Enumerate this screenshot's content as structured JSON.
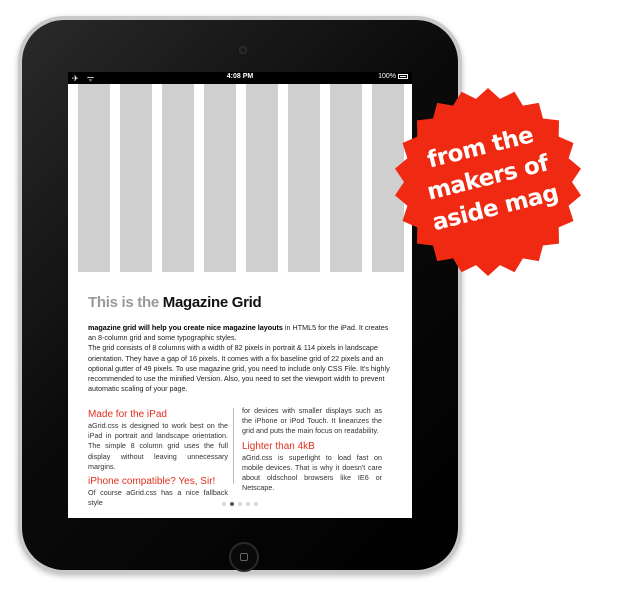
{
  "status_bar": {
    "left_icons": [
      "airplane-icon",
      "wifi-icon"
    ],
    "left_glyphs": "✈ ᯤ",
    "time": "4:08 PM",
    "battery": "100%"
  },
  "grid": {
    "columns": 8
  },
  "title": {
    "prefix": "This is the",
    "main": "Magazine Grid"
  },
  "intro": {
    "bold": "magazine grid will help you create nice magazine layouts",
    "rest": " in HTML5 for the iPad. It creates an 8-column grid and some typographic styles.",
    "p2": "The grid consists of 8 columns with a width of 82 pixels in portrait & 114 pixels in landscape orientation. They have a gap of 16 pixels. It comes with a fix baseline grid of 22 pixels and an optional gutter of 49 pixels. To use magazine grid, you need to include only CSS File. It's highly recommended to use the minified Version. Also, you need to set the viewport width to prevent automatic scaling of your page."
  },
  "left_column": {
    "head1": "Made for the iPad",
    "text1": "aGrid.css is designed to work best on the iPad in portrait and landscape orientation. The simple 8 column grid uses the full display without leaving unnecessary margins.",
    "head2": "iPhone compatible? Yes, Sir!",
    "text2": "Of course aGrid.css has a nice fallback style"
  },
  "right_column": {
    "text0": "for devices with smaller displays such as the iPhone or iPod Touch. It linearizes the grid and puts the main focus on readability.",
    "head": "Lighter than 4kB",
    "text": "aGrid.css is superlight to load fast on mobile devices. That is why it doesn't care about oldschool browsers like IE6 or Netscape."
  },
  "pager": {
    "count": 5,
    "active_index": 1
  },
  "badge": {
    "line1": "from the",
    "line2": "makers of",
    "line3": "aside mag",
    "color": "#f02a12"
  },
  "colors": {
    "accent": "#e0301e",
    "grid_column": "#cfcfcf",
    "device_body": "#000000"
  }
}
